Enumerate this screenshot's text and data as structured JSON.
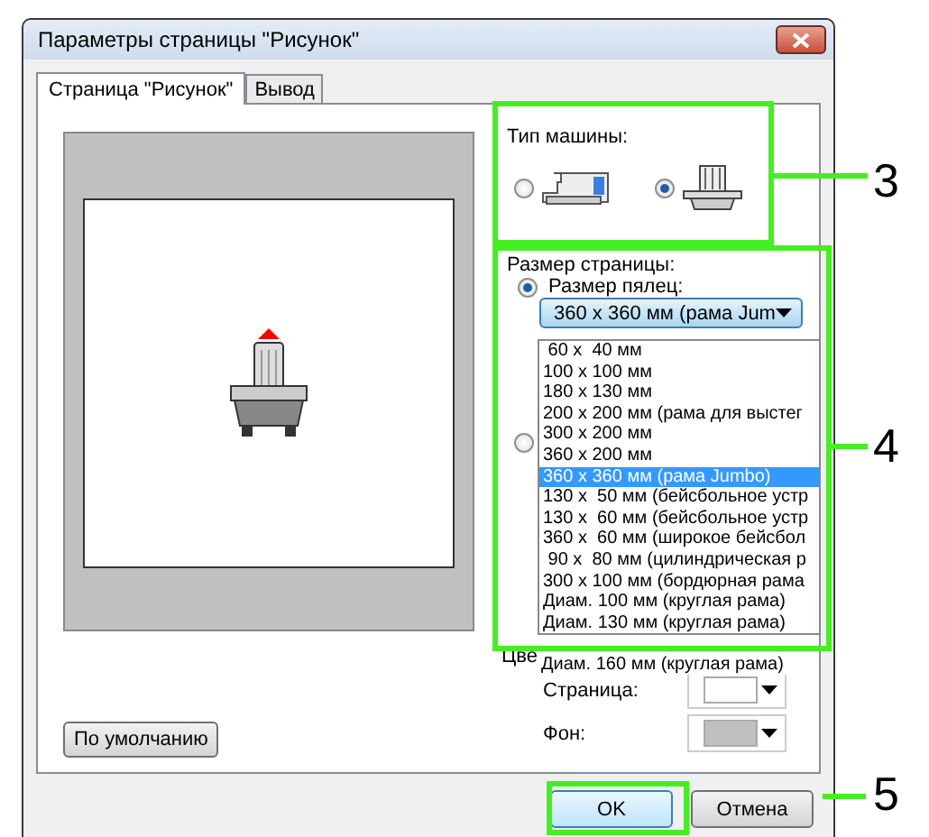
{
  "window": {
    "title": "Параметры страницы \"Рисунок\""
  },
  "tabs": [
    {
      "label": "Страница \"Рисунок\"",
      "selected": true
    },
    {
      "label": "Вывод",
      "selected": false
    }
  ],
  "machine_type": {
    "label": "Тип машины:",
    "options": [
      {
        "kind": "household",
        "selected": false
      },
      {
        "kind": "multi-needle",
        "selected": true
      }
    ]
  },
  "page_size": {
    "label": "Размер страницы:",
    "hoop_radio": {
      "label": "Размер пялец:",
      "selected": true
    },
    "hoop_dropdown": {
      "value": "360 x 360 мм (рама Jum"
    },
    "other_radio": {
      "selected": false
    },
    "hoop_list": [
      {
        "label": " 60 x  40 мм",
        "selected": false
      },
      {
        "label": "100 x 100 мм",
        "selected": false
      },
      {
        "label": "180 x 130 мм",
        "selected": false
      },
      {
        "label": "200 x 200 мм (рама для выстег",
        "selected": false
      },
      {
        "label": "300 x 200 мм",
        "selected": false
      },
      {
        "label": "360 x 200 мм",
        "selected": false
      },
      {
        "label": "360 x 360 мм (рама Jumbo)",
        "selected": true
      },
      {
        "label": "130 x  50 мм (бейсбольное устр",
        "selected": false
      },
      {
        "label": "130 x  60 мм (бейсбольное устр",
        "selected": false
      },
      {
        "label": "360 x  60 мм (широкое бейсбол",
        "selected": false
      },
      {
        "label": " 90 x  80 мм (цилиндрическая р",
        "selected": false
      },
      {
        "label": "300 x 100 мм (бордюрная рама",
        "selected": false
      },
      {
        "label": "Диам. 100 мм (круглая рама)",
        "selected": false
      },
      {
        "label": "Диам. 130 мм (круглая рама)",
        "selected": false
      }
    ],
    "overflow_item": {
      "label": "Диам. 160 мм (круглая рама)"
    }
  },
  "colors": {
    "label": "Цве",
    "swatches": [
      {
        "label": "Страница:",
        "color": "#ffffff"
      },
      {
        "label": "Фон:",
        "color": "#c0c0c0"
      }
    ]
  },
  "default_button": "По умолчанию",
  "buttons": [
    {
      "label": "OK",
      "kind": "default"
    },
    {
      "label": "Отмена",
      "kind": "normal"
    }
  ],
  "callouts": [
    {
      "number": "3"
    },
    {
      "number": "4"
    },
    {
      "number": "5"
    }
  ]
}
